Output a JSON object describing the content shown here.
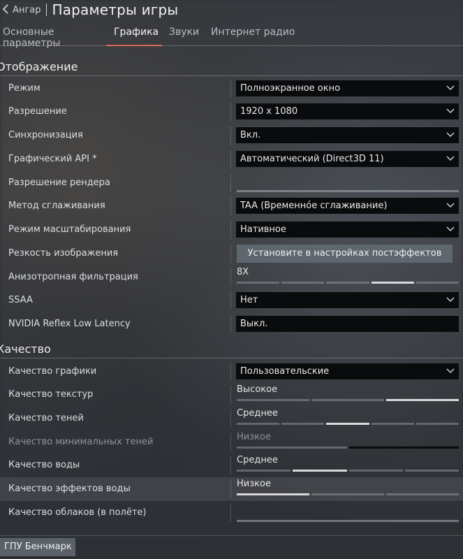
{
  "header": {
    "back_label": "Ангар",
    "title": "Параметры игры"
  },
  "tabs": [
    {
      "label": "Основные параметры"
    },
    {
      "label": "Графика"
    },
    {
      "label": "Звуки"
    },
    {
      "label": "Интернет радио"
    }
  ],
  "display": {
    "title": "Отображение",
    "mode": {
      "label": "Режим",
      "value": "Полноэкранное окно"
    },
    "resolution": {
      "label": "Разрешение",
      "value": "1920 x 1080"
    },
    "vsync": {
      "label": "Синхронизация",
      "value": "Вкл."
    },
    "api": {
      "label": "Графический API *",
      "value": "Автоматический (Direct3D 11)"
    },
    "render_res": {
      "label": "Разрешение рендера"
    },
    "aa": {
      "label": "Метод сглаживания",
      "value": "TAA (Временно́е сглаживание)"
    },
    "scaling": {
      "label": "Режим масштабирования",
      "value": "Нативное"
    },
    "sharpness": {
      "label": "Резкость изображения",
      "button": "Установите в настройках постэффектов"
    },
    "aniso": {
      "label": "Анизотропная фильтрация",
      "value": "8X",
      "level": 4,
      "steps": 5
    },
    "ssaa": {
      "label": "SSAA",
      "value": "Нет"
    },
    "reflex": {
      "label": "NVIDIA Reflex Low Latency",
      "value": "Выкл."
    }
  },
  "quality": {
    "title": "Качество",
    "graphics": {
      "label": "Качество графики",
      "value": "Пользовательские"
    },
    "textures": {
      "label": "Качество текстур",
      "value": "Высокое",
      "level": 3,
      "steps": 3
    },
    "shadows": {
      "label": "Качество теней",
      "value": "Среднее",
      "level": 3,
      "steps": 5
    },
    "min_shadows": {
      "label": "Качество минимальных теней",
      "value": "Низкое",
      "level": 1,
      "steps": 2
    },
    "water": {
      "label": "Качество воды",
      "value": "Среднее",
      "level": 2,
      "steps": 4
    },
    "water_fx": {
      "label": "Качество эффектов воды",
      "value": "Низкое",
      "level": 1,
      "steps": 3
    },
    "clouds": {
      "label": "Качество облаков (в полёте)"
    }
  },
  "footer": {
    "gpu_benchmark": "ГПУ Бенчмарк"
  },
  "colors": {
    "accent": "#e0563f",
    "select_bg": "#0a0b0d",
    "button_bg": "#5e666e"
  }
}
